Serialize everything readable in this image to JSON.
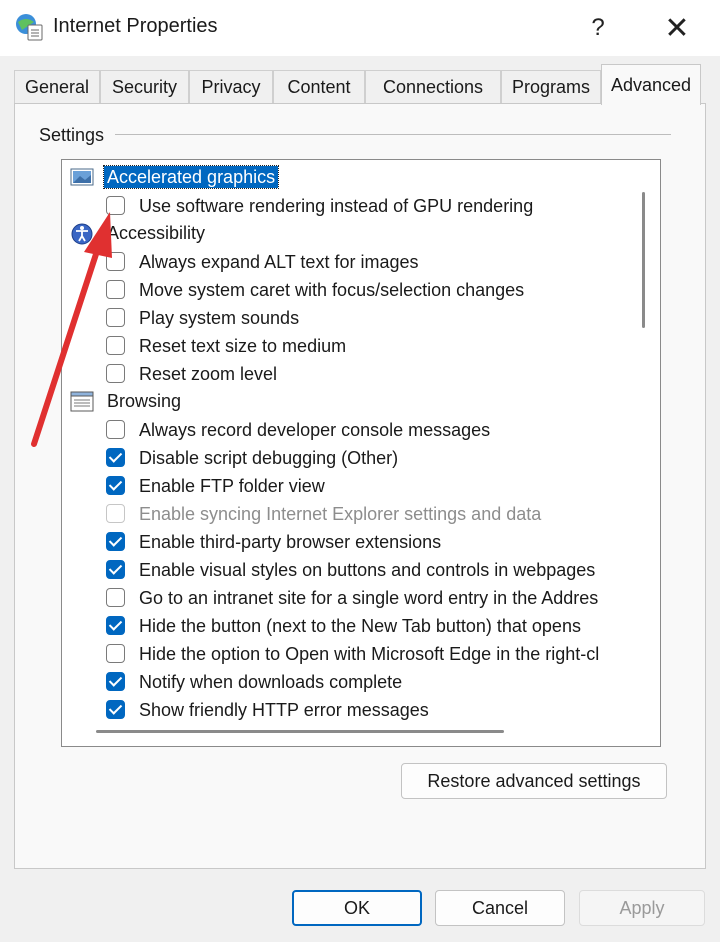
{
  "window": {
    "title": "Internet Properties",
    "help_glyph": "?",
    "close_glyph": "✕"
  },
  "tabs": [
    {
      "label": "General"
    },
    {
      "label": "Security"
    },
    {
      "label": "Privacy"
    },
    {
      "label": "Content"
    },
    {
      "label": "Connections"
    },
    {
      "label": "Programs"
    },
    {
      "label": "Advanced",
      "active": true
    }
  ],
  "settings": {
    "group_label": "Settings",
    "categories": {
      "accelerated_graphics": {
        "label": "Accelerated graphics",
        "icon": "monitor-icon",
        "selected": true
      },
      "accessibility": {
        "label": "Accessibility",
        "icon": "accessibility-icon"
      },
      "browsing": {
        "label": "Browsing",
        "icon": "browsing-icon"
      }
    },
    "items": [
      {
        "label": "Use software rendering instead of GPU rendering",
        "checked": false
      },
      {
        "label": "Always expand ALT text for images",
        "checked": false
      },
      {
        "label": "Move system caret with focus/selection changes",
        "checked": false
      },
      {
        "label": "Play system sounds",
        "checked": false
      },
      {
        "label": "Reset text size to medium",
        "checked": false
      },
      {
        "label": "Reset zoom level",
        "checked": false
      },
      {
        "label": "Always record developer console messages",
        "checked": false
      },
      {
        "label": "Disable script debugging (Other)",
        "checked": true
      },
      {
        "label": "Enable FTP folder view",
        "checked": true
      },
      {
        "label": "Enable syncing Internet Explorer settings and data",
        "checked": false,
        "disabled": true
      },
      {
        "label": "Enable third-party browser extensions",
        "checked": true
      },
      {
        "label": "Enable visual styles on buttons and controls in webpages",
        "checked": true
      },
      {
        "label": "Go to an intranet site for a single word entry in the Addres",
        "checked": false
      },
      {
        "label": "Hide the button (next to the New Tab button) that opens",
        "checked": true
      },
      {
        "label": "Hide the option to Open with Microsoft Edge in the right-cl",
        "checked": false
      },
      {
        "label": "Notify when downloads complete",
        "checked": true
      },
      {
        "label": "Show friendly HTTP error messages",
        "checked": true
      }
    ]
  },
  "buttons": {
    "restore": "Restore advanced settings",
    "ok": "OK",
    "cancel": "Cancel",
    "apply": "Apply"
  },
  "colors": {
    "accent": "#0067c0",
    "annotation_arrow": "#e03030"
  }
}
